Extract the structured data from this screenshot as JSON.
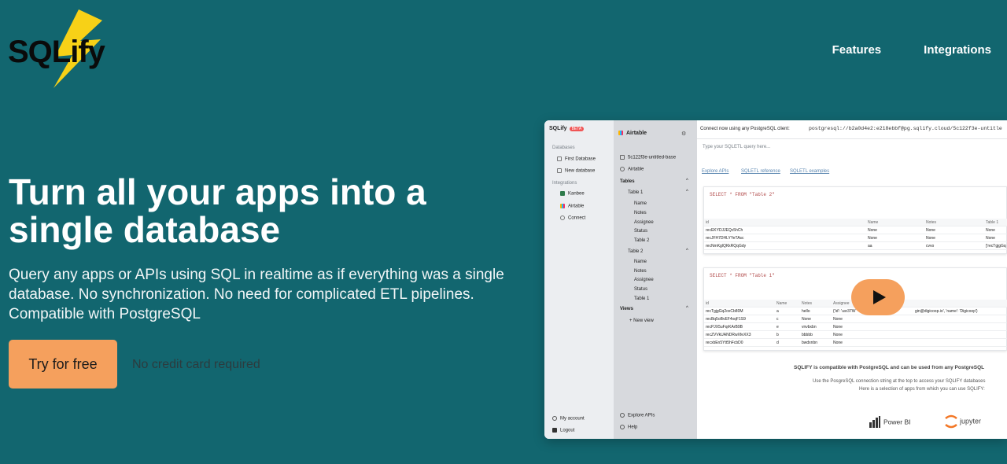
{
  "header": {
    "logo_text": "SQLify",
    "nav": [
      {
        "label": "Features"
      },
      {
        "label": "Integrations"
      }
    ]
  },
  "hero": {
    "title": "Turn all your apps into a single database",
    "subtitle": "Query any apps or APIs using SQL in realtime as if everything was a single database. No synchronization. No need for complicated ETL pipelines. Compatible with PostgreSQL",
    "cta_label": "Try for free",
    "cta_note": "No credit card required"
  },
  "app": {
    "brand": "SQLify",
    "beta": "BETA",
    "sidebar": {
      "databases_heading": "Databases",
      "databases": [
        "First Database",
        "New database"
      ],
      "integrations_heading": "Integrations",
      "integrations": [
        "Kanbee",
        "Airtable",
        "Connect"
      ],
      "footer": [
        "My account",
        "Logout"
      ]
    },
    "panel": {
      "title": "Airtable",
      "base": "5c122f3e-untitled-base",
      "source": "Airtable",
      "tables_heading": "Tables",
      "tables": [
        {
          "name": "Table 1",
          "fields": [
            "Name",
            "Notes",
            "Assignee",
            "Status",
            "Table 2"
          ]
        },
        {
          "name": "Table 2",
          "fields": [
            "Name",
            "Notes",
            "Assignee",
            "Status",
            "Table 1"
          ]
        }
      ],
      "views_heading": "Views",
      "new_view": "New view",
      "footer": [
        "Explore APIs",
        "Help"
      ]
    },
    "main": {
      "connect_label": "Connect now using any PostgreSQL client:",
      "connect_string": "postgresql://b2a0d4e2:e218ebbf@pg.sqlify.cloud/5c122f3e-untitle",
      "query_placeholder": "Type your SQLETL query here...",
      "links": [
        "Explore APIs",
        "SQLETL reference",
        "SQLETL examples"
      ],
      "query1": {
        "sql": "SELECT * FROM \"Table 2\"",
        "columns": [
          "id",
          "Name",
          "Notes",
          "Table 1"
        ],
        "rows": [
          [
            "recEKYDJJEQc5hCh",
            "None",
            "None",
            "None"
          ],
          [
            "recJFH7DHLYYeTAsc",
            "None",
            "None",
            "None"
          ],
          [
            "recNmKglQKkRQqGdy",
            "aa",
            "cvvo",
            "['recTgjgGq"
          ]
        ]
      },
      "query2": {
        "sql": "SELECT * FROM \"Table 1\"",
        "columns": [
          "id",
          "Name",
          "Notes",
          "Assignee"
        ],
        "rows": [
          [
            "recTgjgGq2oxCb80M",
            "a",
            "hello",
            "{'id': 'usr37W",
            "gin@digicoop.io', 'name': 'Digicoop'}"
          ],
          [
            "recBq5oBvEF4xqF1S9",
            "c",
            "None",
            "None",
            ""
          ],
          [
            "recPJX5uFqrKArB9B",
            "e",
            "vnvbxbn",
            "None",
            ""
          ],
          [
            "recZVVkUANDRwXfeXX3",
            "b",
            "bbbbb",
            "None",
            ""
          ],
          [
            "recxbEn5Ytt5hFcbD0",
            "d",
            "bwdxnbn",
            "None",
            ""
          ]
        ]
      },
      "compat_title": "SQLIFY is compatible with PostgreSQL and can be used from any PostgreSQL",
      "compat_line1": "Use the PosgreSQL connection string at the top to access your SQLIFY databases",
      "compat_line2": "Here is a selection of apps from which you can use SQLIFY:",
      "apps": [
        "Power BI",
        "jupyter"
      ]
    }
  },
  "colors": {
    "background": "#12666f",
    "cta": "#f5a05d",
    "bolt": "#f7d117"
  }
}
